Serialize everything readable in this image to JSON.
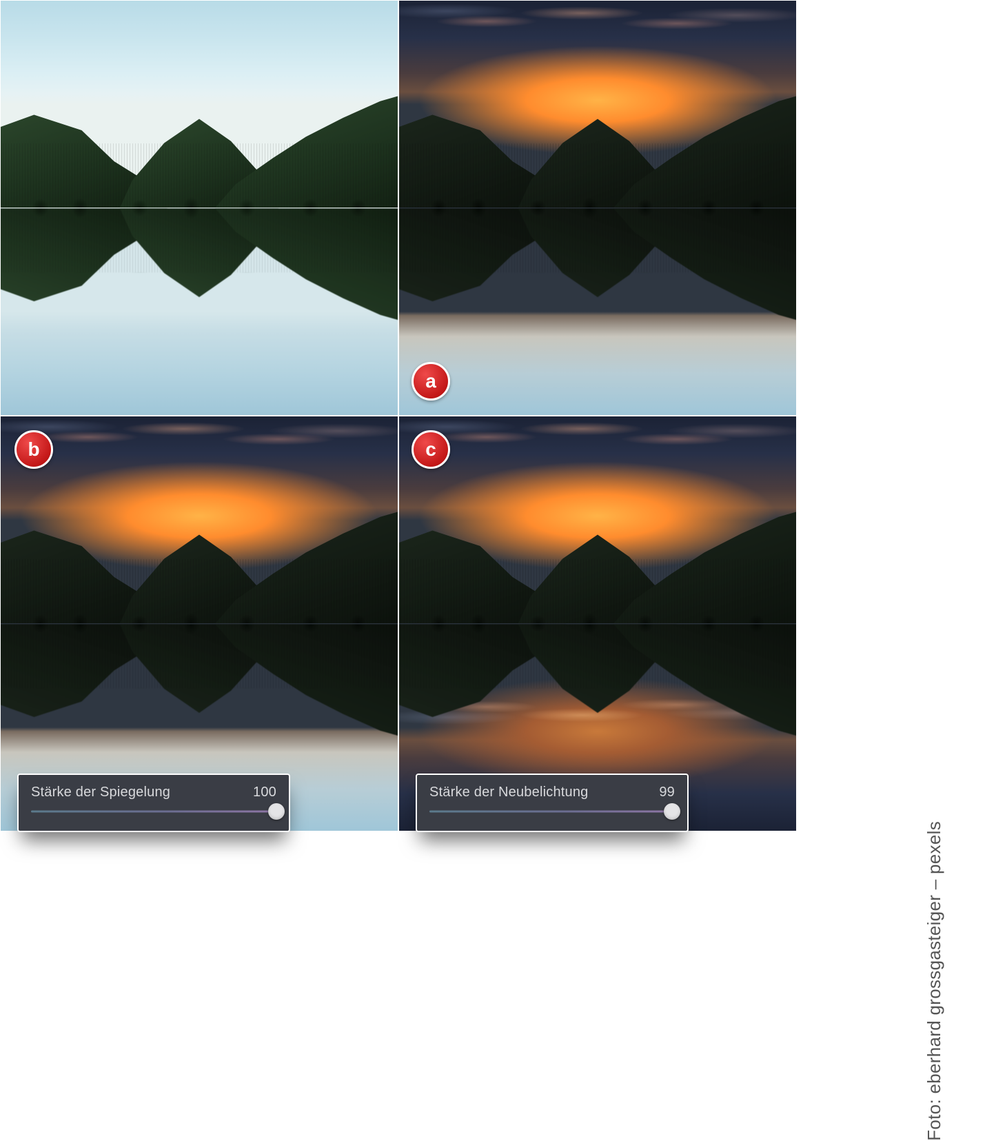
{
  "badges": {
    "a": "a",
    "b": "b",
    "c": "c"
  },
  "sliders": {
    "reflection": {
      "label": "Stärke der Spiegelung",
      "value": "100",
      "percent": 100
    },
    "relight": {
      "label": "Stärke der Neubelichtung",
      "value": "99",
      "percent": 99
    }
  },
  "credit": "Foto: eberhard grossgasteiger – pexels",
  "colors": {
    "badge": "#c41818",
    "panel_bg": "#3a3d45"
  }
}
